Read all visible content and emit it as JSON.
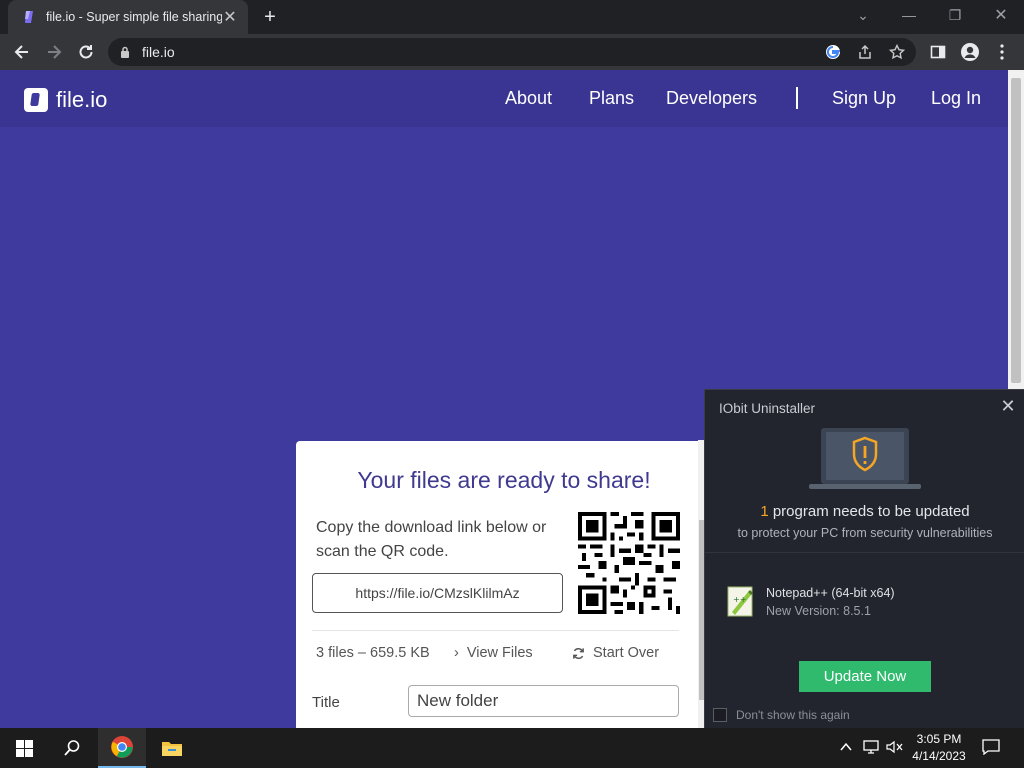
{
  "browser": {
    "tab_title": "file.io - Super simple file sharing",
    "address": "file.io"
  },
  "site": {
    "brand": "file.io",
    "nav": [
      {
        "label": "About"
      },
      {
        "label": "Plans"
      },
      {
        "label": "Developers"
      },
      {
        "label": "Sign Up"
      },
      {
        "label": "Log In"
      }
    ]
  },
  "card": {
    "heading": "Your files are ready to share!",
    "instructions": "Copy the download link below or scan the QR code.",
    "link": "https://file.io/CMzslKlilmAz",
    "summary": "3 files – 659.5 KB",
    "view_files": "View Files",
    "start_over": "Start Over",
    "title_label": "Title",
    "title_value": "New folder"
  },
  "popup": {
    "title": "IObit Uninstaller",
    "count": "1",
    "headline_rest": "program needs to be updated",
    "subline": "to protect your PC from security vulnerabilities",
    "app_name": "Notepad++ (64-bit x64)",
    "app_version": "New Version: 8.5.1",
    "update_button": "Update Now",
    "dont_show": "Don't show this again",
    "accent": "#2fba6e"
  },
  "taskbar": {
    "time": "3:05 PM",
    "date": "4/14/2023"
  },
  "colors": {
    "page_bg": "#3f3a9e",
    "header_bg": "#3a3592",
    "heading": "#3f3a8f"
  }
}
